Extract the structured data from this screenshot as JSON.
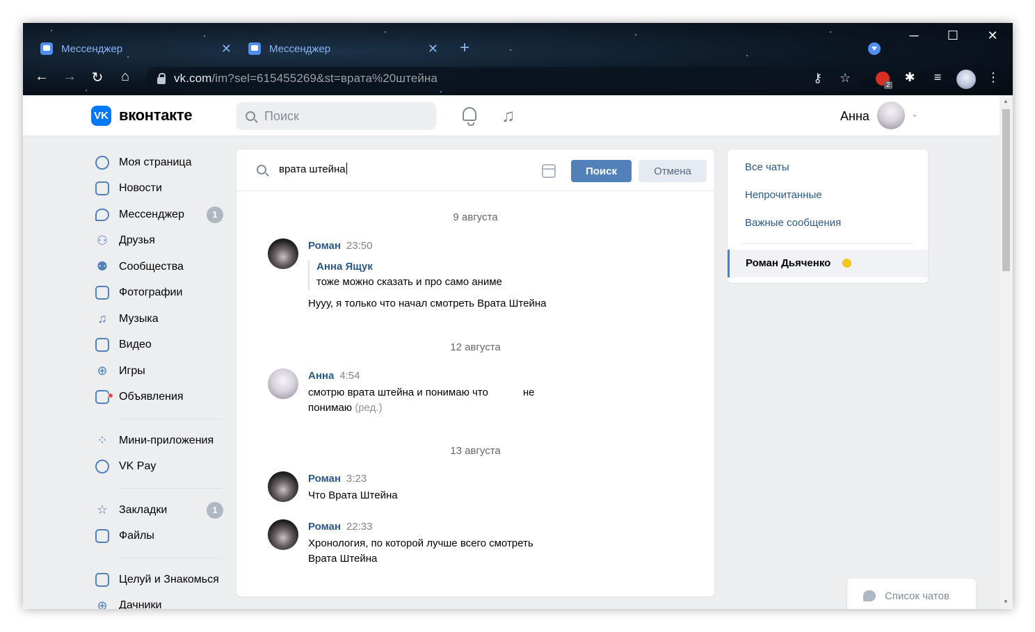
{
  "browser": {
    "tabs": [
      {
        "title": "Мессенджер",
        "close": "✕"
      },
      {
        "title": "Мессенджер",
        "close": "✕"
      }
    ],
    "new_tab": "+",
    "window_controls": {
      "minimize": "─",
      "maximize": "☐",
      "close": "✕"
    },
    "address": {
      "host": "vk.com",
      "path": "/im?sel=615455269&st=врата%20штейна"
    },
    "nav": {
      "back": "←",
      "forward": "→",
      "reload": "↻",
      "home": "⌂"
    },
    "omnibox_icons": {
      "key": "key-icon",
      "star": "☆"
    },
    "extensions": {
      "badge": "2",
      "puzzle": "puzzle-icon",
      "media": "playlist-icon",
      "menu": "⋮"
    }
  },
  "header": {
    "brand": "вконтакте",
    "logo_text": "VK",
    "search_placeholder": "Поиск",
    "user_name": "Анна",
    "chevron": "⌄"
  },
  "left_menu": {
    "items": [
      {
        "label": "Моя страница",
        "icon": "user-circle-icon"
      },
      {
        "label": "Новости",
        "icon": "news-icon"
      },
      {
        "label": "Мессенджер",
        "icon": "message-icon",
        "badge": "1"
      },
      {
        "label": "Друзья",
        "icon": "friends-icon"
      },
      {
        "label": "Сообщества",
        "icon": "communities-icon"
      },
      {
        "label": "Фотографии",
        "icon": "photo-icon"
      },
      {
        "label": "Музыка",
        "icon": "music-icon"
      },
      {
        "label": "Видео",
        "icon": "video-icon"
      },
      {
        "label": "Игры",
        "icon": "gamepad-icon"
      },
      {
        "label": "Объявления",
        "icon": "ads-icon"
      }
    ],
    "items2": [
      {
        "label": "Мини-приложения",
        "icon": "apps-icon"
      },
      {
        "label": "VK Pay",
        "icon": "vkpay-icon"
      }
    ],
    "items3": [
      {
        "label": "Закладки",
        "icon": "star-icon",
        "badge": "1"
      },
      {
        "label": "Файлы",
        "icon": "file-icon"
      }
    ],
    "items4": [
      {
        "label": "Целуй и Знакомься",
        "icon": "briefcase-icon"
      },
      {
        "label": "Дачники",
        "icon": "game-icon"
      }
    ]
  },
  "search_bar": {
    "query": "врата штейна",
    "search_button": "Поиск",
    "cancel_button": "Отмена"
  },
  "messages": {
    "groups": [
      {
        "date": "9 августа",
        "author": "Роман",
        "time": "23:50",
        "quote_author": "Анна Ящук",
        "quote_text": "тоже можно сказать и про само аниме",
        "text": "Нууу, я только что начал смотреть Врата Штейна"
      },
      {
        "date": "12 августа",
        "author": "Анна",
        "time": "4:54",
        "text_line1": "смотрю врата штейна и понимаю что            не",
        "text_line2": "понимаю",
        "edited": "(ред.)"
      },
      {
        "date": "13 августа",
        "author": "Роман",
        "time": "3:23",
        "text": "Что Врата Штейна"
      },
      {
        "author": "Роман",
        "time": "22:33",
        "text_line1": "Хронология, по которой лучше всего смотреть",
        "text_line2": "Врата Штейна"
      }
    ]
  },
  "right_panel": {
    "all_chats": "Все чаты",
    "unread": "Непрочитанные",
    "important": "Важные сообщения",
    "active_chat": "Роман Дьяченко"
  },
  "chat_list_button": "Список чатов",
  "colors": {
    "accent": "#5181b8",
    "link": "#2a5885",
    "vk_blue": "#0077ff",
    "background": "#edeef0"
  }
}
